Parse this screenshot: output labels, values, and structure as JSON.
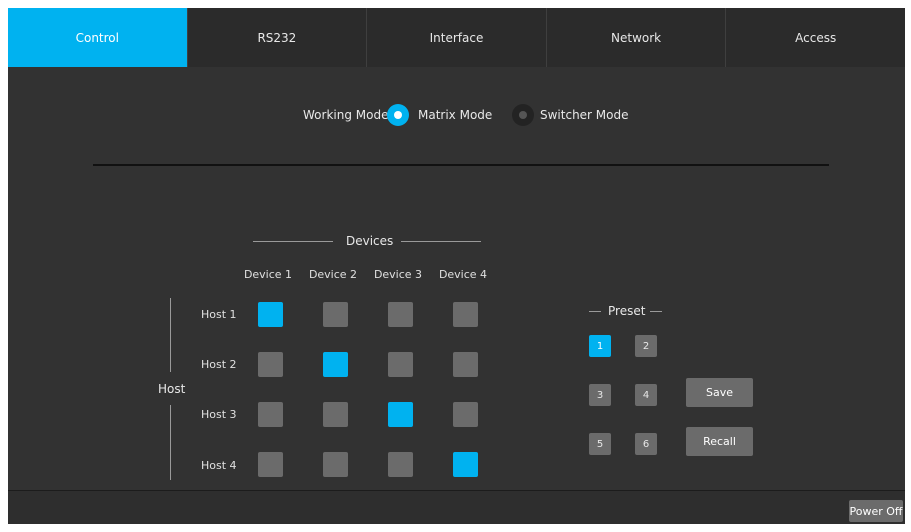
{
  "tabs": [
    "Control",
    "RS232",
    "Interface",
    "Network",
    "Access"
  ],
  "active_tab": "Control",
  "working_mode": {
    "label": "Working Mode:",
    "options": [
      "Matrix Mode",
      "Switcher Mode"
    ],
    "selected": "Matrix Mode"
  },
  "matrix": {
    "devices_title": "Devices",
    "host_title": "Host",
    "devices": [
      "Device 1",
      "Device 2",
      "Device 3",
      "Device 4"
    ],
    "hosts": [
      "Host 1",
      "Host 2",
      "Host 3",
      "Host 4"
    ],
    "selected": [
      [
        true,
        false,
        false,
        false
      ],
      [
        false,
        true,
        false,
        false
      ],
      [
        false,
        false,
        true,
        false
      ],
      [
        false,
        false,
        false,
        true
      ]
    ]
  },
  "preset": {
    "title": "Preset",
    "buttons": [
      "1",
      "2",
      "3",
      "4",
      "5",
      "6"
    ],
    "selected": "1",
    "save_label": "Save",
    "recall_label": "Recall"
  },
  "footer": {
    "power_label": "Power Off"
  },
  "colors": {
    "accent": "#00b2f0",
    "background": "#323232",
    "cell": "#6b6b6b"
  }
}
